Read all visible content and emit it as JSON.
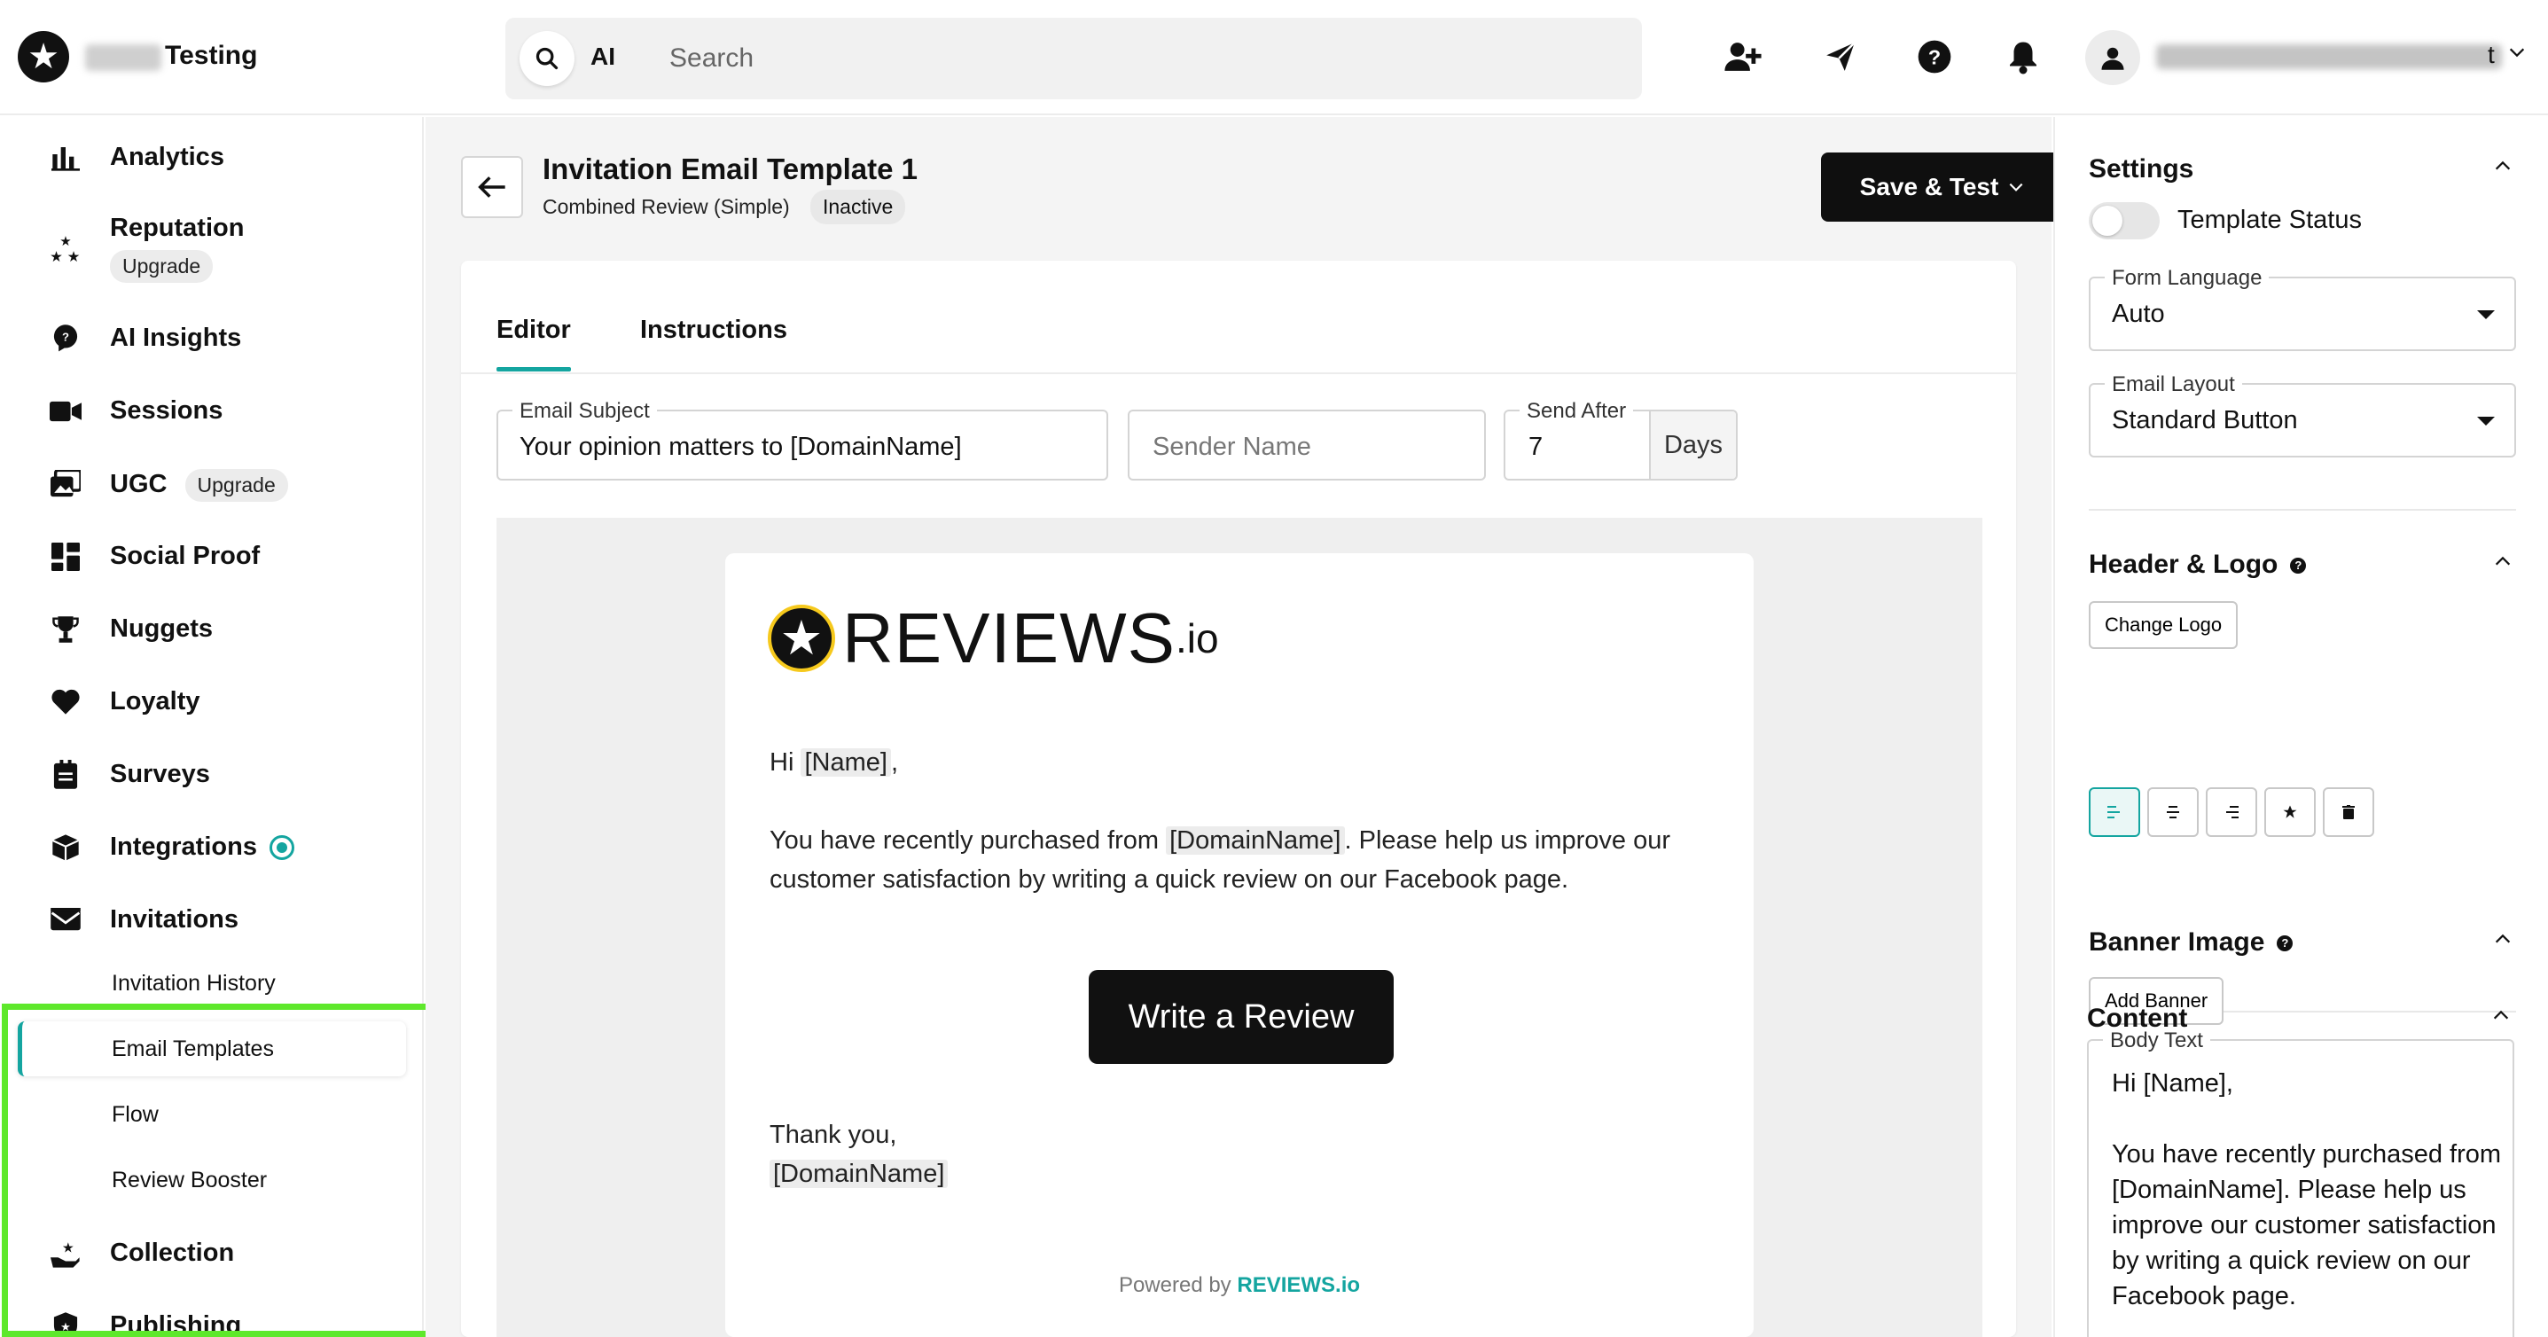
{
  "header": {
    "brand_name": "Testing",
    "search": {
      "ai_label": "AI",
      "placeholder": "Search"
    },
    "user_email_suffix": "t"
  },
  "sidebar": {
    "items": [
      {
        "label": "Analytics",
        "icon": "bar-chart-icon"
      },
      {
        "label": "Reputation",
        "badge": "Upgrade",
        "icon": "stars-icon"
      },
      {
        "label": "AI Insights",
        "icon": "ai-bulb-icon"
      },
      {
        "label": "Sessions",
        "icon": "video-camera-icon"
      },
      {
        "label": "UGC",
        "badge": "Upgrade",
        "icon": "image-gallery-icon"
      },
      {
        "label": "Social Proof",
        "icon": "widgets-icon"
      },
      {
        "label": "Nuggets",
        "icon": "trophy-icon"
      },
      {
        "label": "Loyalty",
        "icon": "heart-icon"
      },
      {
        "label": "Surveys",
        "icon": "clipboard-icon"
      },
      {
        "label": "Integrations",
        "icon": "cube-icon"
      },
      {
        "label": "Invitations",
        "icon": "envelope-icon"
      },
      {
        "label": "Collection",
        "icon": "star-hand-icon"
      },
      {
        "label": "Publishing",
        "icon": "shield-icon"
      }
    ],
    "invitations_sub": [
      {
        "label": "Invitation History"
      },
      {
        "label": "Email Templates",
        "active": true
      },
      {
        "label": "Flow"
      },
      {
        "label": "Review Booster"
      }
    ]
  },
  "main": {
    "title": "Invitation Email Template 1",
    "subtitle": "Combined Review (Simple)",
    "status": "Inactive",
    "save_button": "Save & Test",
    "tabs": [
      {
        "label": "Editor",
        "active": true
      },
      {
        "label": "Instructions"
      }
    ],
    "fields": {
      "subject_label": "Email Subject",
      "subject_value": "Your opinion matters to [DomainName]",
      "sender_placeholder": "Sender Name",
      "send_after_label": "Send After",
      "send_after_value": "7",
      "send_after_unit": "Days"
    },
    "email_preview": {
      "logo_wordmark": "REVIEWS",
      "logo_suffix": ".io",
      "greeting_prefix": "Hi",
      "greeting_tag": "[Name]",
      "greeting_suffix": ",",
      "body_prefix": "You have recently purchased from",
      "body_tag": "[DomainName]",
      "body_suffix": ". Please help us improve our",
      "body_line2": "customer satisfaction by writing a quick review on our Facebook page.",
      "cta": "Write a Review",
      "signoff": "Thank you,",
      "signoff_tag": "[DomainName]",
      "powered_prefix": "Powered by",
      "powered_brand": "REVIEWS.io"
    }
  },
  "settings_panel": {
    "settings_title": "Settings",
    "template_status_label": "Template Status",
    "template_status_on": false,
    "form_language_label": "Form Language",
    "form_language_value": "Auto",
    "email_layout_label": "Email Layout",
    "email_layout_value": "Standard Button",
    "header_logo_title": "Header & Logo",
    "change_logo_button": "Change Logo",
    "banner_title": "Banner Image",
    "add_banner_button": "Add Banner",
    "content_title": "Content",
    "body_text_label": "Body Text",
    "body_text_value": "Hi [Name],\n\nYou have recently purchased from [DomainName]. Please help us improve our customer satisfaction by writing a quick review on our Facebook page."
  },
  "colors": {
    "accent": "#14a5a0",
    "highlight": "#5ee82b",
    "dark_button": "#0f0f0f"
  }
}
